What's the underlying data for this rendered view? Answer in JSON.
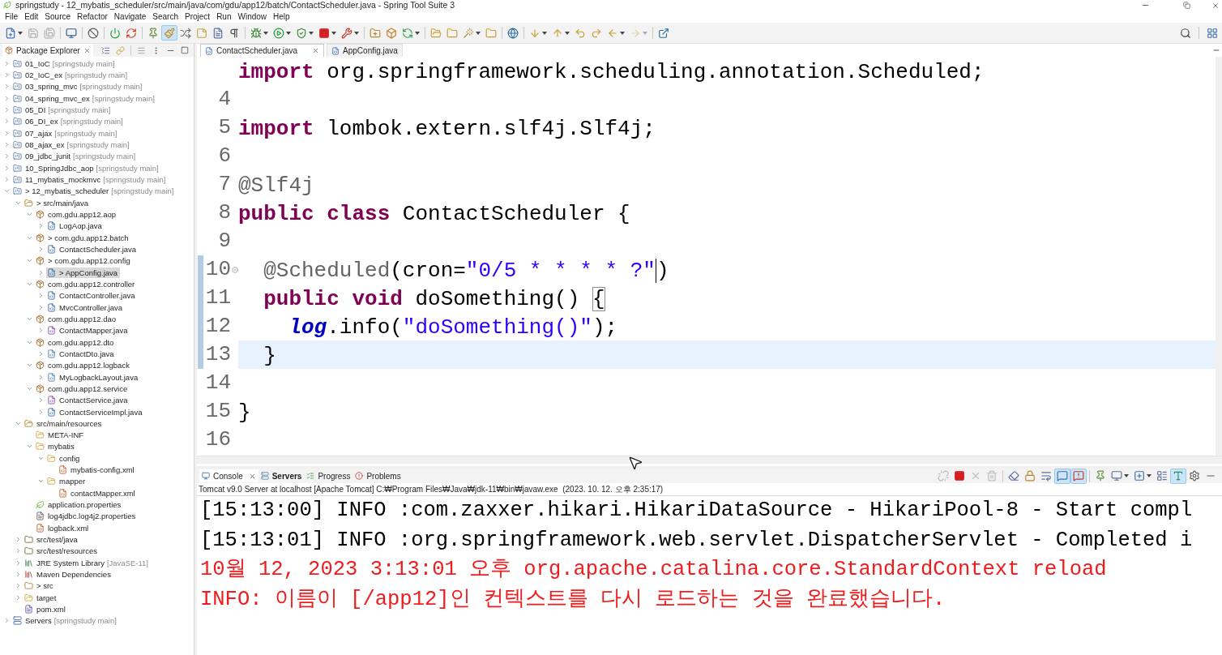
{
  "window": {
    "title": "springstudy - 12_mybatis_scheduler/src/main/java/com/gdu/app12/batch/ContactScheduler.java - Spring Tool Suite 3"
  },
  "menu": [
    "File",
    "Edit",
    "Source",
    "Refactor",
    "Navigate",
    "Search",
    "Project",
    "Run",
    "Window",
    "Help"
  ],
  "main_toolbar": {
    "left_groups": [
      [
        {
          "kind": "new",
          "menu": true,
          "pressed": false,
          "disabled": false
        },
        {
          "kind": "save",
          "menu": false,
          "pressed": false,
          "disabled": true
        },
        {
          "kind": "save-all",
          "menu": false,
          "pressed": false,
          "disabled": true
        }
      ],
      [
        {
          "kind": "monitor",
          "menu": false,
          "pressed": false,
          "disabled": false
        }
      ],
      [
        {
          "kind": "skip",
          "menu": false,
          "pressed": false,
          "disabled": false
        }
      ],
      [
        {
          "kind": "power",
          "menu": false,
          "pressed": false,
          "disabled": false
        },
        {
          "kind": "relaunch",
          "menu": false,
          "pressed": false,
          "disabled": false
        }
      ],
      [
        {
          "kind": "pin",
          "menu": false,
          "pressed": false,
          "disabled": false
        },
        {
          "kind": "brush",
          "menu": false,
          "pressed": true,
          "disabled": false
        },
        {
          "kind": "shuffle",
          "menu": false,
          "pressed": false,
          "disabled": false
        },
        {
          "kind": "notes",
          "menu": false,
          "pressed": false,
          "disabled": false
        },
        {
          "kind": "doc",
          "menu": false,
          "pressed": false,
          "disabled": false
        },
        {
          "kind": "pilcrow",
          "menu": false,
          "pressed": false,
          "disabled": false
        }
      ],
      [
        {
          "kind": "bug",
          "menu": true,
          "pressed": false,
          "disabled": false
        },
        {
          "kind": "run",
          "menu": true,
          "pressed": false,
          "disabled": false
        },
        {
          "kind": "coverage",
          "menu": true,
          "pressed": false,
          "disabled": false
        },
        {
          "kind": "stop",
          "menu": true,
          "pressed": false,
          "disabled": false
        },
        {
          "kind": "tools",
          "menu": true,
          "pressed": false,
          "disabled": false
        }
      ],
      [
        {
          "kind": "new-package",
          "menu": false,
          "pressed": false,
          "disabled": false
        },
        {
          "kind": "new-class",
          "menu": false,
          "pressed": false,
          "disabled": false
        },
        {
          "kind": "refresh",
          "menu": true,
          "pressed": false,
          "disabled": false
        }
      ],
      [
        {
          "kind": "open-folder",
          "menu": false,
          "pressed": false,
          "disabled": false
        },
        {
          "kind": "folder",
          "menu": false,
          "pressed": false,
          "disabled": false
        },
        {
          "kind": "wand",
          "menu": true,
          "pressed": false,
          "disabled": false
        },
        {
          "kind": "folder",
          "menu": false,
          "pressed": false,
          "disabled": false
        }
      ],
      [
        {
          "kind": "globe",
          "menu": false,
          "pressed": false,
          "disabled": false
        }
      ],
      [
        {
          "kind": "down",
          "menu": true,
          "pressed": false,
          "disabled": false
        },
        {
          "kind": "up",
          "menu": true,
          "pressed": false,
          "disabled": false
        },
        {
          "kind": "undo",
          "menu": false,
          "pressed": false,
          "disabled": false
        },
        {
          "kind": "redo",
          "menu": false,
          "pressed": false,
          "disabled": false
        },
        {
          "kind": "back",
          "menu": true,
          "pressed": false,
          "disabled": false
        },
        {
          "kind": "forward",
          "menu": true,
          "pressed": false,
          "disabled": true
        }
      ],
      [
        {
          "kind": "external",
          "menu": false,
          "pressed": false,
          "disabled": false
        }
      ]
    ],
    "right_groups": [
      [
        {
          "kind": "search",
          "menu": false,
          "pressed": false,
          "disabled": false
        }
      ],
      [
        {
          "kind": "perspective",
          "menu": false,
          "pressed": false,
          "disabled": false
        }
      ]
    ]
  },
  "package_explorer": {
    "tab": "Package Explorer",
    "tree": [
      {
        "label": "01_IoC",
        "decoration": "[springstudy main]",
        "kind": "project",
        "expanded": false,
        "selected": false
      },
      {
        "label": "02_IoC_ex",
        "decoration": "[springstudy main]",
        "kind": "project",
        "expanded": false,
        "selected": false
      },
      {
        "label": "03_spring_mvc",
        "decoration": "[springstudy main]",
        "kind": "project",
        "expanded": false,
        "selected": false
      },
      {
        "label": "04_spring_mvc_ex",
        "decoration": "[springstudy main]",
        "kind": "project",
        "expanded": false,
        "selected": false
      },
      {
        "label": "05_DI",
        "decoration": "[springstudy main]",
        "kind": "project",
        "expanded": false,
        "selected": false
      },
      {
        "label": "06_DI_ex",
        "decoration": "[springstudy main]",
        "kind": "project",
        "expanded": false,
        "selected": false
      },
      {
        "label": "07_ajax",
        "decoration": "[springstudy main]",
        "kind": "project",
        "expanded": false,
        "selected": false
      },
      {
        "label": "08_ajax_ex",
        "decoration": "[springstudy main]",
        "kind": "project",
        "expanded": false,
        "selected": false
      },
      {
        "label": "09_jdbc_junit",
        "decoration": "[springstudy main]",
        "kind": "project",
        "expanded": false,
        "selected": false
      },
      {
        "label": "10_SpringJdbc_aop",
        "decoration": "[springstudy main]",
        "kind": "project",
        "expanded": false,
        "selected": false
      },
      {
        "label": "11_mybatis_mockmvc",
        "decoration": "[springstudy main]",
        "kind": "project",
        "expanded": false,
        "selected": false
      },
      {
        "label": "> 12_mybatis_scheduler",
        "decoration": "[springstudy main]",
        "kind": "project",
        "expanded": true,
        "selected": false,
        "children": [
          {
            "label": "> src/main/java",
            "kind": "source-folder",
            "expanded": true,
            "selected": false,
            "children": [
              {
                "label": "com.gdu.app12.aop",
                "kind": "package",
                "expanded": true,
                "selected": false,
                "children": [
                  {
                    "label": "LogAop.java",
                    "kind": "class",
                    "expanded": false,
                    "selected": false
                  }
                ]
              },
              {
                "label": "> com.gdu.app12.batch",
                "kind": "package",
                "expanded": true,
                "selected": false,
                "children": [
                  {
                    "label": "ContactScheduler.java",
                    "kind": "class",
                    "expanded": false,
                    "selected": false
                  }
                ]
              },
              {
                "label": "> com.gdu.app12.config",
                "kind": "package",
                "expanded": true,
                "selected": false,
                "children": [
                  {
                    "label": "> AppConfig.java",
                    "kind": "class",
                    "expanded": false,
                    "selected": true
                  }
                ]
              },
              {
                "label": "com.gdu.app12.controller",
                "kind": "package",
                "expanded": true,
                "selected": false,
                "children": [
                  {
                    "label": "ContactController.java",
                    "kind": "class",
                    "expanded": false,
                    "selected": false
                  },
                  {
                    "label": "MvcController.java",
                    "kind": "class",
                    "expanded": false,
                    "selected": false
                  }
                ]
              },
              {
                "label": "com.gdu.app12.dao",
                "kind": "package",
                "expanded": true,
                "selected": false,
                "children": [
                  {
                    "label": "ContactMapper.java",
                    "kind": "interface",
                    "expanded": false,
                    "selected": false
                  }
                ]
              },
              {
                "label": "com.gdu.app12.dto",
                "kind": "package",
                "expanded": true,
                "selected": false,
                "children": [
                  {
                    "label": "ContactDto.java",
                    "kind": "java",
                    "expanded": false,
                    "selected": false
                  }
                ]
              },
              {
                "label": "com.gdu.app12.logback",
                "kind": "package",
                "expanded": true,
                "selected": false,
                "children": [
                  {
                    "label": "MyLogbackLayout.java",
                    "kind": "java",
                    "expanded": false,
                    "selected": false
                  }
                ]
              },
              {
                "label": "com.gdu.app12.service",
                "kind": "package",
                "expanded": true,
                "selected": false,
                "children": [
                  {
                    "label": "ContactService.java",
                    "kind": "interface",
                    "expanded": false,
                    "selected": false
                  },
                  {
                    "label": "ContactServiceImpl.java",
                    "kind": "class",
                    "expanded": false,
                    "selected": false
                  }
                ]
              }
            ]
          },
          {
            "label": "src/main/resources",
            "kind": "source-folder",
            "expanded": true,
            "selected": false,
            "children": [
              {
                "label": "META-INF",
                "kind": "folder",
                "selected": false
              },
              {
                "label": "mybatis",
                "kind": "folder",
                "expanded": true,
                "selected": false,
                "children": [
                  {
                    "label": "config",
                    "kind": "folder",
                    "expanded": true,
                    "selected": false,
                    "children": [
                      {
                        "label": "mybatis-config.xml",
                        "kind": "xml",
                        "selected": false
                      }
                    ]
                  },
                  {
                    "label": "mapper",
                    "kind": "folder",
                    "expanded": true,
                    "selected": false,
                    "children": [
                      {
                        "label": "contactMapper.xml",
                        "kind": "xml",
                        "selected": false
                      }
                    ]
                  }
                ]
              },
              {
                "label": "application.properties",
                "kind": "spring-properties",
                "selected": false
              },
              {
                "label": "log4jdbc.log4j2.properties",
                "kind": "text-file",
                "selected": false
              },
              {
                "label": "logback.xml",
                "kind": "xml",
                "selected": false
              }
            ]
          },
          {
            "label": "src/test/java",
            "kind": "test-folder",
            "expanded": false,
            "selected": false
          },
          {
            "label": "src/test/resources",
            "kind": "test-folder",
            "expanded": false,
            "selected": false
          },
          {
            "label": "JRE System Library",
            "decoration": "[JavaSE-11]",
            "kind": "library",
            "expanded": false,
            "selected": false
          },
          {
            "label": "Maven Dependencies",
            "kind": "maven",
            "expanded": false,
            "selected": false
          },
          {
            "label": "> src",
            "kind": "project-folder",
            "expanded": false,
            "selected": false
          },
          {
            "label": "target",
            "kind": "folder",
            "expanded": false,
            "selected": false
          },
          {
            "label": "pom.xml",
            "kind": "maven-file",
            "selected": false
          }
        ]
      },
      {
        "label": "Servers",
        "decoration": "[springstudy main]",
        "kind": "servers",
        "expanded": false,
        "selected": false
      }
    ]
  },
  "editor": {
    "tabs": [
      {
        "label": "ContactScheduler.java",
        "selected": true
      },
      {
        "label": "AppConfig.java",
        "selected": false
      }
    ],
    "lines": [
      {
        "changed": false,
        "foldable": false,
        "current": false,
        "tokens": [
          {
            "kind": "keyword",
            "text": "import",
            "matched": false,
            "caret": false
          },
          {
            "kind": "plain",
            "text": " org.springframework.scheduling.annotation.Scheduled;",
            "matched": false,
            "caret": false
          }
        ]
      },
      {
        "number": "4",
        "changed": false,
        "foldable": false,
        "current": false
      },
      {
        "number": "5",
        "changed": false,
        "foldable": false,
        "current": false,
        "tokens": [
          {
            "kind": "keyword",
            "text": "import",
            "matched": false,
            "caret": false
          },
          {
            "kind": "plain",
            "text": " lombok.extern.slf4j.Slf4j;",
            "matched": false,
            "caret": false
          }
        ]
      },
      {
        "number": "6",
        "changed": false,
        "foldable": false,
        "current": false
      },
      {
        "number": "7",
        "changed": false,
        "foldable": false,
        "current": false,
        "tokens": [
          {
            "kind": "annotation",
            "text": "@Slf4j",
            "matched": false,
            "caret": false
          }
        ]
      },
      {
        "number": "8",
        "changed": false,
        "foldable": false,
        "current": false,
        "tokens": [
          {
            "kind": "keyword",
            "text": "public",
            "matched": false,
            "caret": false
          },
          {
            "kind": "keyword",
            "text": " class",
            "matched": false,
            "caret": false
          },
          {
            "kind": "plain",
            "text": " ContactScheduler {",
            "matched": false,
            "caret": false
          }
        ]
      },
      {
        "number": "9",
        "changed": false,
        "foldable": false,
        "current": false
      },
      {
        "number": "10",
        "changed": true,
        "foldable": true,
        "current": false,
        "tokens": [
          {
            "kind": "annotation",
            "text": "  @Scheduled",
            "matched": false,
            "caret": false
          },
          {
            "kind": "plain",
            "text": "(cron=",
            "matched": false,
            "caret": false
          },
          {
            "kind": "string",
            "text": "\"0/5 * * * * ?\"",
            "matched": false,
            "caret": true
          },
          {
            "kind": "plain",
            "text": ")",
            "matched": false,
            "caret": false
          }
        ]
      },
      {
        "number": "11",
        "changed": true,
        "foldable": false,
        "current": false,
        "tokens": [
          {
            "kind": "keyword",
            "text": "  public",
            "matched": false,
            "caret": false
          },
          {
            "kind": "keyword",
            "text": " void",
            "matched": false,
            "caret": false
          },
          {
            "kind": "plain",
            "text": " doSomething() ",
            "matched": false,
            "caret": false
          },
          {
            "kind": "plain",
            "text": "{",
            "matched": true,
            "caret": false
          }
        ]
      },
      {
        "number": "12",
        "changed": true,
        "foldable": false,
        "current": false,
        "tokens": [
          {
            "kind": "field",
            "text": "    log",
            "matched": false,
            "caret": false
          },
          {
            "kind": "plain",
            "text": ".info(",
            "matched": false,
            "caret": false
          },
          {
            "kind": "string",
            "text": "\"doSomething()\"",
            "matched": false,
            "caret": false
          },
          {
            "kind": "plain",
            "text": ");",
            "matched": false,
            "caret": false
          }
        ]
      },
      {
        "number": "13",
        "changed": true,
        "foldable": false,
        "current": true,
        "tokens": [
          {
            "kind": "plain",
            "text": "  }",
            "matched": false,
            "caret": false
          }
        ]
      },
      {
        "number": "14",
        "changed": false,
        "foldable": false,
        "current": false
      },
      {
        "number": "15",
        "changed": false,
        "foldable": false,
        "current": false,
        "tokens": [
          {
            "kind": "plain",
            "text": "}",
            "matched": false,
            "caret": false
          }
        ]
      },
      {
        "number": "16",
        "changed": false,
        "foldable": false,
        "current": false
      }
    ]
  },
  "console": {
    "tabs": [
      {
        "label": "Console",
        "kind": "console",
        "selected": true,
        "changed": false
      },
      {
        "label": "Servers",
        "kind": "servers",
        "selected": false,
        "changed": true
      },
      {
        "label": "Progress",
        "kind": "progress",
        "selected": false,
        "changed": false
      },
      {
        "label": "Problems",
        "kind": "problems",
        "selected": false,
        "changed": false
      }
    ],
    "toolbar_groups": [
      [
        {
          "kind": "unlink",
          "menu": false,
          "pressed": false,
          "disabled": true
        },
        {
          "kind": "stop",
          "menu": false,
          "pressed": false,
          "disabled": false
        },
        {
          "kind": "remove",
          "menu": false,
          "pressed": false,
          "disabled": true
        },
        {
          "kind": "remove-all",
          "menu": false,
          "pressed": false,
          "disabled": true
        }
      ],
      [
        {
          "kind": "clear",
          "menu": false,
          "pressed": false,
          "disabled": false
        },
        {
          "kind": "lock",
          "menu": false,
          "pressed": false,
          "disabled": false
        },
        {
          "kind": "wrap",
          "menu": false,
          "pressed": false,
          "disabled": false
        },
        {
          "kind": "stdout",
          "menu": false,
          "pressed": true,
          "disabled": false
        },
        {
          "kind": "stderr",
          "menu": false,
          "pressed": true,
          "disabled": false
        }
      ],
      [
        {
          "kind": "pin",
          "menu": false,
          "pressed": false,
          "disabled": false
        },
        {
          "kind": "display",
          "menu": true,
          "pressed": false,
          "disabled": false
        },
        {
          "kind": "open-console",
          "menu": true,
          "pressed": false,
          "disabled": false
        },
        {
          "kind": "layout",
          "menu": false,
          "pressed": false,
          "disabled": false
        },
        {
          "kind": "ac",
          "menu": false,
          "pressed": true,
          "disabled": false
        },
        {
          "kind": "settings",
          "menu": false,
          "pressed": false,
          "disabled": false
        },
        {
          "kind": "minimize",
          "menu": false,
          "pressed": false,
          "disabled": false
        }
      ]
    ],
    "description": "Tomcat v9.0 Server at localhost [Apache Tomcat] C:₩Program Files₩Java₩jdk-11₩bin₩javaw.exe  (2023. 10. 12. 오후 2:35:17)",
    "lines": [
      {
        "kind": "stdout",
        "text": "[15:13:00] INFO :com.zaxxer.hikari.HikariDataSource - HikariPool-8 - Start compl"
      },
      {
        "kind": "stdout",
        "text": "[15:13:01] INFO :org.springframework.web.servlet.DispatcherServlet - Completed i"
      },
      {
        "kind": "stderr",
        "text": "10월 12, 2023 3:13:01 오후 org.apache.catalina.core.StandardContext reload"
      },
      {
        "kind": "stderr",
        "text": "INFO: 이름이 [/app12]인 컨텍스트를 다시 로드하는 것을 완료했습니다."
      }
    ]
  }
}
